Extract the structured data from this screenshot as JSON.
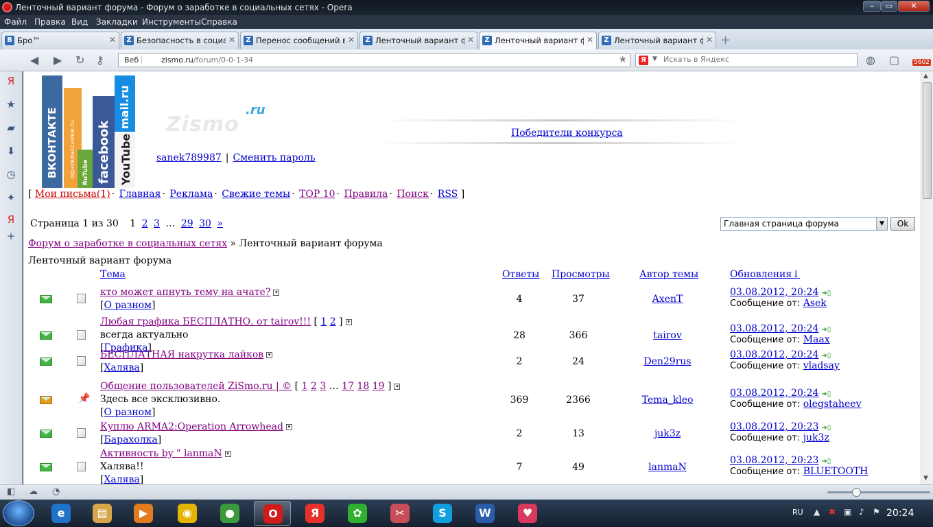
{
  "window": {
    "title": "Ленточный вариант форума - Форум о заработке в социальных сетях - Opera",
    "min": "–",
    "max": "▭",
    "close": "✕"
  },
  "menu": [
    "Файл",
    "Правка",
    "Вид",
    "Закладки",
    "Инструменты",
    "Справка"
  ],
  "tabs": [
    {
      "label": "Бро™",
      "fav": "B"
    },
    {
      "label": "Безопасность в социальн...",
      "fav": "Z"
    },
    {
      "label": "Перенос сообщений в ...",
      "fav": "Z"
    },
    {
      "label": "Ленточный вариант ф...",
      "fav": "Z"
    },
    {
      "label": "Ленточный вариант ф...",
      "fav": "Z"
    },
    {
      "label": "Ленточный вариант ф...",
      "fav": "Z"
    }
  ],
  "address": {
    "mode": "Веб",
    "host": "zismo.ru",
    "path": "/forum/0-0-1-34",
    "search_placeholder": "Искать в Яндекс",
    "search_logo": "Я",
    "badge": "5602"
  },
  "site": {
    "banner_texts": [
      "ВКОНТАКТЕ",
      "одноклассники.ru",
      "RuTube",
      "facebook",
      "mail.ru",
      "YouTube"
    ],
    "brand": "Zismo",
    "brand_suffix": ".ru",
    "contest_link": "Победители конкурса",
    "username": "sanek789987",
    "change_password": "Сменить пароль",
    "nav": {
      "open": "[",
      "close": "]",
      "items": [
        "Мои письма(1)",
        "Главная",
        "Реклама",
        "Свежие темы",
        "TOP 10",
        "Правила",
        "Поиск",
        "RSS"
      ]
    },
    "pager": {
      "label": "Страница 1 из 30",
      "current": "1",
      "pages": [
        "2",
        "3"
      ],
      "ellipsis": "…",
      "tail": [
        "29",
        "30"
      ],
      "next": "»"
    },
    "forum_select": "Главная страница форума",
    "ok": "Ok",
    "breadcrumb": {
      "link": "Форум о заработке в социальных сетях",
      "sep": "»",
      "current": "Ленточный вариант форума"
    },
    "heading": "Ленточный вариант форума",
    "columns": {
      "topic": "Тема",
      "replies": "Ответы",
      "views": "Просмотры",
      "author": "Автор темы",
      "updates": "Обновления↓"
    },
    "msg_from": "Сообщение от:"
  },
  "topics": [
    {
      "title": "кто может апнуть тему на ачате?",
      "pages": [],
      "desc": "",
      "category": "О разном",
      "replies": "4",
      "views": "37",
      "author": "AxenT",
      "date": "03.08.2012, 20:24",
      "last": "Asek",
      "hot": false
    },
    {
      "title": "Любая графика БЕСПЛАТНО. от tairov!!!",
      "pages": [
        "1",
        "2"
      ],
      "desc": "всегда актуально",
      "category": "Графика",
      "replies": "28",
      "views": "366",
      "author": "tairov",
      "date": "03.08.2012, 20:24",
      "last": "Maax",
      "hot": false
    },
    {
      "title": "БЕСПЛАТНАЯ накрутка лайков",
      "pages": [],
      "desc": "",
      "category": "Халява",
      "replies": "2",
      "views": "24",
      "author": "Den29rus",
      "date": "03.08.2012, 20:24",
      "last": "vladsay",
      "hot": false
    },
    {
      "title": "Общение пользователей ZiSmo.ru | ©",
      "pages": [
        "1",
        "2",
        "3",
        "…",
        "17",
        "18",
        "19"
      ],
      "desc": "Здесь все эксклюзивно.",
      "category": "О разном",
      "replies": "369",
      "views": "2366",
      "author": "Tema_kleo",
      "date": "03.08.2012, 20:24",
      "last": "olegstaheev",
      "hot": true
    },
    {
      "title": "Куплю ARMA2:Operation Arrowhead",
      "pages": [],
      "desc": "",
      "category": "Барахолка",
      "replies": "2",
      "views": "13",
      "author": "juk3z",
      "date": "03.08.2012, 20:23",
      "last": "juk3z",
      "hot": false
    },
    {
      "title": "Активность by \" lanmaN",
      "pages": [],
      "desc": "Халява!!",
      "category": "Халява",
      "replies": "7",
      "views": "49",
      "author": "lanmaN",
      "date": "03.08.2012, 20:23",
      "last": "BLUETOOTH",
      "hot": false
    }
  ],
  "taskbar": {
    "apps": [
      {
        "name": "internet-explorer",
        "glyph": "e",
        "color": "#1f73c8"
      },
      {
        "name": "explorer",
        "glyph": "▤",
        "color": "#d8a64a"
      },
      {
        "name": "media-player",
        "glyph": "▶",
        "color": "#e27a1e"
      },
      {
        "name": "bittorrent",
        "glyph": "◉",
        "color": "#e5b400"
      },
      {
        "name": "chrome",
        "glyph": "●",
        "color": "#3b9a3b"
      },
      {
        "name": "opera",
        "glyph": "O",
        "color": "#d21b1b"
      },
      {
        "name": "yandex",
        "glyph": "Я",
        "color": "#e5322a"
      },
      {
        "name": "icq",
        "glyph": "✿",
        "color": "#2fb12f"
      },
      {
        "name": "snipping-tool",
        "glyph": "✂",
        "color": "#c84f5a"
      },
      {
        "name": "skype",
        "glyph": "S",
        "color": "#10a0e0"
      },
      {
        "name": "word",
        "glyph": "W",
        "color": "#2b5caa"
      },
      {
        "name": "qip",
        "glyph": "♥",
        "color": "#d83a5c"
      }
    ],
    "lang": "RU",
    "time": "20:24"
  }
}
